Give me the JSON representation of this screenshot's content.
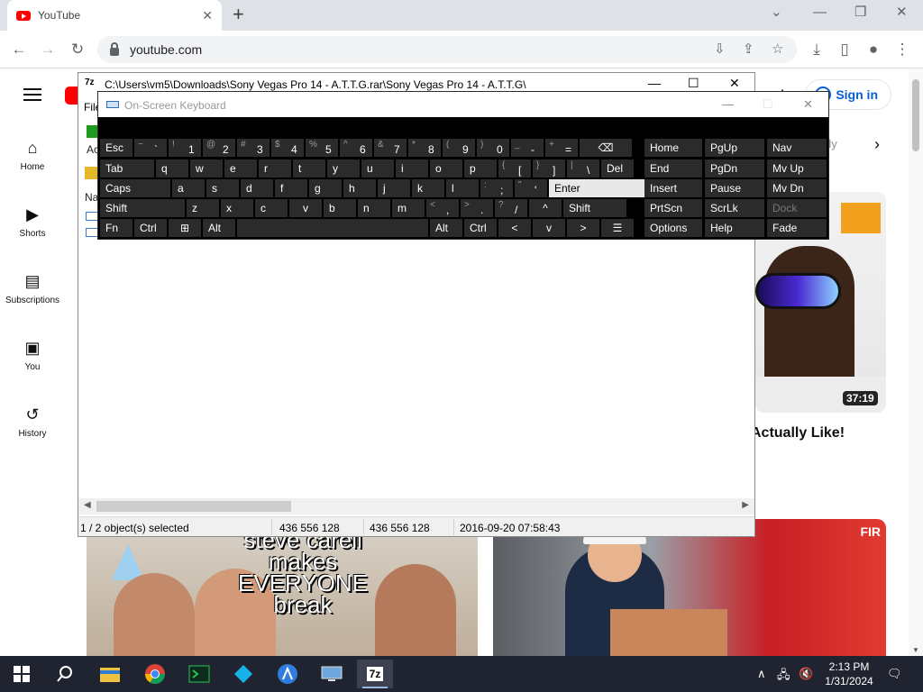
{
  "browser": {
    "tab_title": "YouTube",
    "tab_close": "✕",
    "new_tab": "+",
    "url": "youtube.com"
  },
  "youtube": {
    "nav": [
      "Home",
      "Shorts",
      "Subscriptions",
      "You",
      "History"
    ],
    "sign_in": "Sign in",
    "chip_partial": "dy",
    "video1_duration": "37:19",
    "video1_title": "Actually Like!",
    "video2_text": [
      "steve carell",
      "makes",
      "EVERYONE",
      "break"
    ],
    "video3_badge": "FIR"
  },
  "sevenzip": {
    "icon_label": "7z",
    "title": "C:\\Users\\vm5\\Downloads\\Sony Vegas Pro 14 - A.T.T.G.rar\\Sony Vegas Pro 14 - A.T.T.G\\",
    "menu_partial": "File",
    "toolbar_partial": "Ac",
    "column_partial": "Na",
    "status": {
      "selected": "1 / 2 object(s) selected",
      "size": "436 556 128",
      "packed": "436 556 128",
      "modified": "2016-09-20 07:58:43"
    }
  },
  "osk": {
    "title": "On-Screen Keyboard",
    "rows": [
      [
        {
          "label": "Esc"
        },
        {
          "shift": "~",
          "primary": "`"
        },
        {
          "shift": "!",
          "primary": "1"
        },
        {
          "shift": "@",
          "primary": "2"
        },
        {
          "shift": "#",
          "primary": "3"
        },
        {
          "shift": "$",
          "primary": "4"
        },
        {
          "shift": "%",
          "primary": "5"
        },
        {
          "shift": "^",
          "primary": "6"
        },
        {
          "shift": "&",
          "primary": "7"
        },
        {
          "shift": "*",
          "primary": "8"
        },
        {
          "shift": "(",
          "primary": "9"
        },
        {
          "shift": ")",
          "primary": "0"
        },
        {
          "shift": "_",
          "primary": "-"
        },
        {
          "shift": "+",
          "primary": "="
        },
        {
          "label": "⌫"
        }
      ],
      [
        {
          "label": "Tab"
        },
        {
          "label": "q"
        },
        {
          "label": "w"
        },
        {
          "label": "e"
        },
        {
          "label": "r"
        },
        {
          "label": "t"
        },
        {
          "label": "y"
        },
        {
          "label": "u"
        },
        {
          "label": "i"
        },
        {
          "label": "o"
        },
        {
          "label": "p"
        },
        {
          "shift": "{",
          "primary": "["
        },
        {
          "shift": "}",
          "primary": "]"
        },
        {
          "shift": "|",
          "primary": "\\"
        },
        {
          "label": "Del"
        }
      ],
      [
        {
          "label": "Caps"
        },
        {
          "label": "a"
        },
        {
          "label": "s"
        },
        {
          "label": "d"
        },
        {
          "label": "f"
        },
        {
          "label": "g"
        },
        {
          "label": "h"
        },
        {
          "label": "j"
        },
        {
          "label": "k"
        },
        {
          "label": "l"
        },
        {
          "shift": ":",
          "primary": ";"
        },
        {
          "shift": "\"",
          "primary": "'"
        },
        {
          "label": "Enter"
        }
      ],
      [
        {
          "label": "Shift"
        },
        {
          "label": "z"
        },
        {
          "label": "x"
        },
        {
          "label": "c"
        },
        {
          "label": "v"
        },
        {
          "label": "b"
        },
        {
          "label": "n"
        },
        {
          "label": "m"
        },
        {
          "shift": "<",
          "primary": ","
        },
        {
          "shift": ">",
          "primary": "."
        },
        {
          "shift": "?",
          "primary": "/"
        },
        {
          "label": "^"
        },
        {
          "label": "Shift"
        }
      ],
      [
        {
          "label": "Fn"
        },
        {
          "label": "Ctrl"
        },
        {
          "label": "⊞"
        },
        {
          "label": "Alt"
        },
        {
          "label": ""
        },
        {
          "label": "Alt"
        },
        {
          "label": "Ctrl"
        },
        {
          "label": "<"
        },
        {
          "label": "v"
        },
        {
          "label": ">"
        },
        {
          "label": "☰"
        }
      ]
    ],
    "nav_keys": [
      [
        "Home",
        "PgUp",
        "Nav"
      ],
      [
        "End",
        "PgDn",
        "Mv Up"
      ],
      [
        "Insert",
        "Pause",
        "Mv Dn"
      ],
      [
        "PrtScn",
        "ScrLk",
        "Dock"
      ],
      [
        "Options",
        "Help",
        "Fade"
      ]
    ],
    "highlight": "Enter"
  },
  "taskbar": {
    "time": "2:13 PM",
    "date": "1/31/2024",
    "active_app_label": "7z"
  },
  "colors": {
    "youtube_red": "#ff0000",
    "signin_blue": "#065fd4",
    "osk_key": "#2b2b2b",
    "taskbar": "#1f2430"
  }
}
